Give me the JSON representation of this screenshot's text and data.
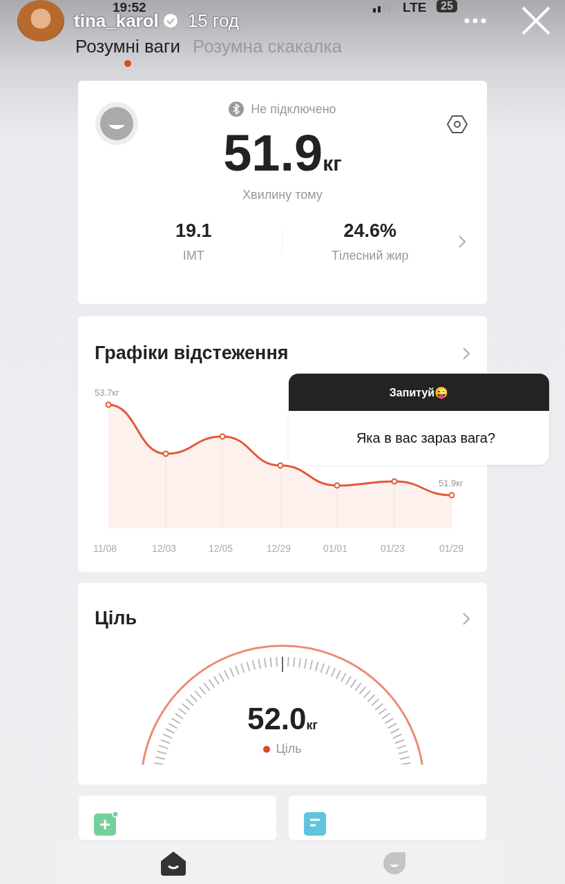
{
  "status_bar": {
    "time": "19:52",
    "network": "LTE",
    "battery": "25"
  },
  "story": {
    "user": "tina_karol",
    "age": "15 год"
  },
  "tabs": [
    {
      "label": "Розумні ваги",
      "selected": true
    },
    {
      "label": "Розумна скакалка",
      "selected": false
    }
  ],
  "scale_card": {
    "connection": "Не підключено",
    "weight": "51.9",
    "unit": "кг",
    "measured": "Хвилину тому",
    "metrics": [
      {
        "value": "19.1",
        "label": "ІМТ"
      },
      {
        "value": "24.6%",
        "label": "Тілесний жир"
      }
    ]
  },
  "trend_card": {
    "title": "Графіки відстеження",
    "first_label": "53.7кг",
    "last_label": "51.9кг",
    "dates": [
      "11/08",
      "12/03",
      "12/05",
      "12/29",
      "01/01",
      "01/23",
      "01/29"
    ]
  },
  "goal_card": {
    "title": "Ціль",
    "weight": "52.0",
    "unit": "кг",
    "legend": "Ціль"
  },
  "question": {
    "header": "Запитуй😜",
    "text": "Яка в вас зараз вага?"
  },
  "nav": [
    {
      "kind": "home",
      "selected": true
    },
    {
      "kind": "device",
      "selected": false
    }
  ]
}
